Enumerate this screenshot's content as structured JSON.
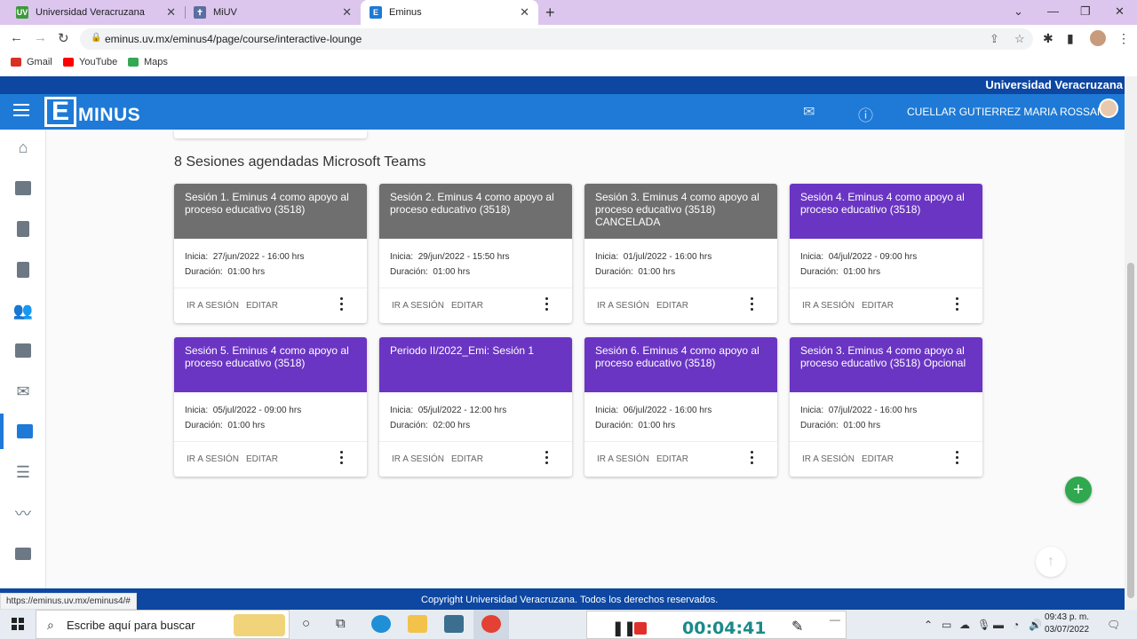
{
  "browser": {
    "tabs": [
      {
        "label": "Universidad Veracruzana",
        "favicon": "UV",
        "color": "#3c9a3c"
      },
      {
        "label": "MiUV",
        "favicon": "✝",
        "color": "#5a6fa0"
      },
      {
        "label": "Eminus",
        "favicon": "E",
        "color": "#1e7ad6"
      }
    ],
    "url": "eminus.uv.mx/eminus4/page/course/interactive-lounge",
    "bookmarks": [
      {
        "label": "Gmail",
        "color": "#d93025"
      },
      {
        "label": "YouTube",
        "color": "#ff0000"
      },
      {
        "label": "Maps",
        "color": "#34a853"
      }
    ]
  },
  "app": {
    "topband_text": "Universidad Veracruzana",
    "logo_letter": "E",
    "logo_rest": "MINUS",
    "user_name": "CUELLAR GUTIERREZ MARIA ROSSANA"
  },
  "main": {
    "section_title": "8 Sesiones agendadas Microsoft Teams",
    "labels": {
      "start": "Inicia:",
      "duration": "Duración:",
      "go": "IR A SESIÓN",
      "edit": "EDITAR"
    },
    "sessions": [
      {
        "title": "Sesión 1. Eminus 4 como apoyo al proceso educativo (3518)",
        "start": "27/jun/2022 - 16:00 hrs",
        "duration": "01:00 hrs",
        "color": "#6f6f6f"
      },
      {
        "title": "Sesión 2. Eminus 4 como apoyo al proceso educativo (3518)",
        "start": "29/jun/2022 - 15:50 hrs",
        "duration": "01:00 hrs",
        "color": "#6f6f6f"
      },
      {
        "title": "Sesión 3. Eminus 4 como apoyo al proceso educativo (3518) CANCELADA",
        "start": "01/jul/2022 - 16:00 hrs",
        "duration": "01:00 hrs",
        "color": "#6f6f6f"
      },
      {
        "title": "Sesión 4. Eminus 4 como apoyo al proceso educativo (3518)",
        "start": "04/jul/2022 - 09:00 hrs",
        "duration": "01:00 hrs",
        "color": "#6a35c2"
      },
      {
        "title": "Sesión 5. Eminus 4 como apoyo al proceso educativo (3518)",
        "start": "05/jul/2022 - 09:00 hrs",
        "duration": "01:00 hrs",
        "color": "#6a35c2"
      },
      {
        "title": "Periodo II/2022_Emi: Sesión 1",
        "start": "05/jul/2022 - 12:00 hrs",
        "duration": "02:00 hrs",
        "color": "#6a35c2"
      },
      {
        "title": "Sesión 6. Eminus 4 como apoyo al proceso educativo (3518)",
        "start": "06/jul/2022 - 16:00 hrs",
        "duration": "01:00 hrs",
        "color": "#6a35c2"
      },
      {
        "title": "Sesión 3. Eminus 4 como apoyo al proceso educativo (3518) Opcional",
        "start": "07/jul/2022 - 16:00 hrs",
        "duration": "01:00 hrs",
        "color": "#6a35c2"
      }
    ]
  },
  "footer": {
    "copyright": "Copyright Universidad Veracruzana. Todos los derechos reservados.",
    "status_url": "https://eminus.uv.mx/eminus4/#"
  },
  "taskbar": {
    "search_placeholder": "Escribe aquí para buscar",
    "recorder_time": "00:04:41",
    "clock_time": "09:43 p. m.",
    "clock_date": "03/07/2022"
  }
}
